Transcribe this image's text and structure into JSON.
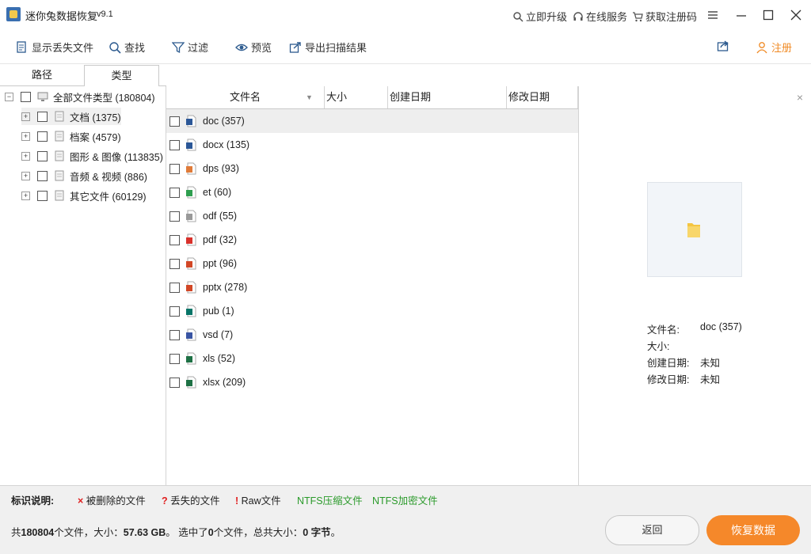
{
  "app": {
    "title": "迷你兔数据恢复",
    "version": "v9.1"
  },
  "titlebar_links": {
    "upgrade": "立即升级",
    "online_service": "在线服务",
    "get_code": "获取注册码"
  },
  "toolbar": {
    "show_lost": "显示丢失文件",
    "find": "查找",
    "filter": "过滤",
    "preview": "预览",
    "export": "导出扫描结果",
    "register": "注册"
  },
  "tabs": {
    "path": "路径",
    "type": "类型"
  },
  "tree": {
    "root": "全部文件类型 (180804)",
    "items": [
      {
        "label": "文档 (1375)",
        "icon": "document-icon"
      },
      {
        "label": "档案 (4579)",
        "icon": "archive-icon"
      },
      {
        "label": "图形 & 图像 (113835)",
        "icon": "image-icon"
      },
      {
        "label": "音频 & 视频 (886)",
        "icon": "media-icon"
      },
      {
        "label": "其它文件 (60129)",
        "icon": "folder-icon"
      }
    ]
  },
  "list": {
    "columns": [
      "文件名",
      "大小",
      "创建日期",
      "修改日期"
    ],
    "rows": [
      {
        "name": "doc (357)",
        "icon": "word-icon",
        "color": "#2b5797"
      },
      {
        "name": "docx (135)",
        "icon": "word-icon",
        "color": "#2b5797"
      },
      {
        "name": "dps (93)",
        "icon": "dps-icon",
        "color": "#e07b39"
      },
      {
        "name": "et (60)",
        "icon": "et-icon",
        "color": "#2e9e4f"
      },
      {
        "name": "odf (55)",
        "icon": "blank-file-icon",
        "color": "#999999"
      },
      {
        "name": "pdf (32)",
        "icon": "pdf-icon",
        "color": "#d9312b"
      },
      {
        "name": "ppt (96)",
        "icon": "ppt-icon",
        "color": "#d24726"
      },
      {
        "name": "pptx (278)",
        "icon": "ppt-icon",
        "color": "#d24726"
      },
      {
        "name": "pub (1)",
        "icon": "publisher-icon",
        "color": "#077568"
      },
      {
        "name": "vsd (7)",
        "icon": "visio-icon",
        "color": "#3955a3"
      },
      {
        "name": "xls (52)",
        "icon": "excel-icon",
        "color": "#1e7145"
      },
      {
        "name": "xlsx (209)",
        "icon": "excel-icon",
        "color": "#1e7145"
      }
    ]
  },
  "preview": {
    "filename_label": "文件名:",
    "filename_value": "doc (357)",
    "size_label": "大小:",
    "created_label": "创建日期:",
    "created_value": "未知",
    "modified_label": "修改日期:",
    "modified_value": "未知"
  },
  "legend": {
    "title": "标识说明:",
    "deleted": "被删除的文件",
    "lost": "丢失的文件",
    "raw": "Raw文件",
    "ntfs_compressed": "NTFS压缩文件",
    "ntfs_encrypted": "NTFS加密文件"
  },
  "status": {
    "prefix": "共",
    "total_files": "180804",
    "files_unit_size": "个文件，大小：",
    "total_size": "57.63 GB",
    "selected_prefix": "。 选中了",
    "selected_count": "0",
    "selected_mid": "个文件，总共大小：",
    "selected_size": "0 字节",
    "suffix": "。"
  },
  "buttons": {
    "back": "返回",
    "recover": "恢复数据"
  },
  "colors": {
    "accent": "#f5882a",
    "deleted_mark": "#e02020",
    "ntfs": "#2a9a2a"
  }
}
